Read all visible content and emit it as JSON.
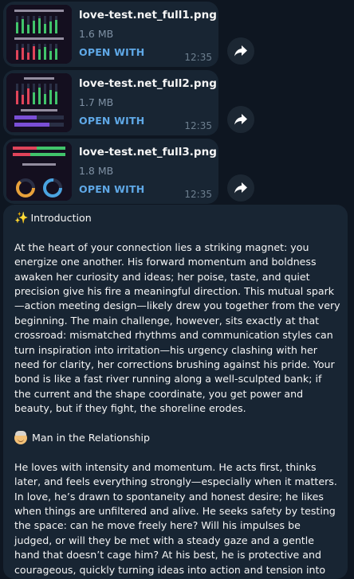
{
  "files": [
    {
      "name": "love-test.net_full1.png",
      "size": "1.6 MB",
      "action": "OPEN WITH",
      "time": "12:35"
    },
    {
      "name": "love-test.net_full2.png",
      "size": "1.7 MB",
      "action": "OPEN WITH",
      "time": "12:35"
    },
    {
      "name": "love-test.net_full3.png",
      "size": "1.8 MB",
      "action": "OPEN WITH",
      "time": "12:35"
    }
  ],
  "message": {
    "intro_emoji": "✨",
    "intro_title": "Introduction",
    "intro_body": "At the heart of your connection lies a striking magnet: you energize one another. His forward momentum and boldness awaken her curiosity and ideas; her poise, taste, and quiet precision give his fire a meaningful direction. This mutual spark—action meeting design—likely drew you together from the very beginning. The main challenge, however, sits exactly at that crossroad: mismatched rhythms and communication styles can turn inspiration into irritation—his urgency clashing with her need for clarity, her corrections brushing against his pride. Your bond is like a fast river running along a well-sculpted bank; if the current and the shape coordinate, you get power and beauty, but if they fight, the shoreline erodes.",
    "man_title": "Man in the Relationship",
    "man_body": "He loves with intensity and momentum. He acts first, thinks later, and feels everything strongly—especially when it matters. In love, he’s drawn to spontaneity and honest desire; he likes when things are unfiltered and alive. He seeks safety by testing the space: can he move freely here? Will his impulses be judged, or will they be met with a steady gaze and a gentle hand that doesn’t cage him? At his best, he is protective and courageous, quickly turning ideas into action and tension into movement. At his wobbly moments, he may"
  },
  "colors": {
    "background": "#0e1621",
    "bubble": "#182533",
    "link": "#5fa8e6",
    "muted": "#7f91a4"
  }
}
